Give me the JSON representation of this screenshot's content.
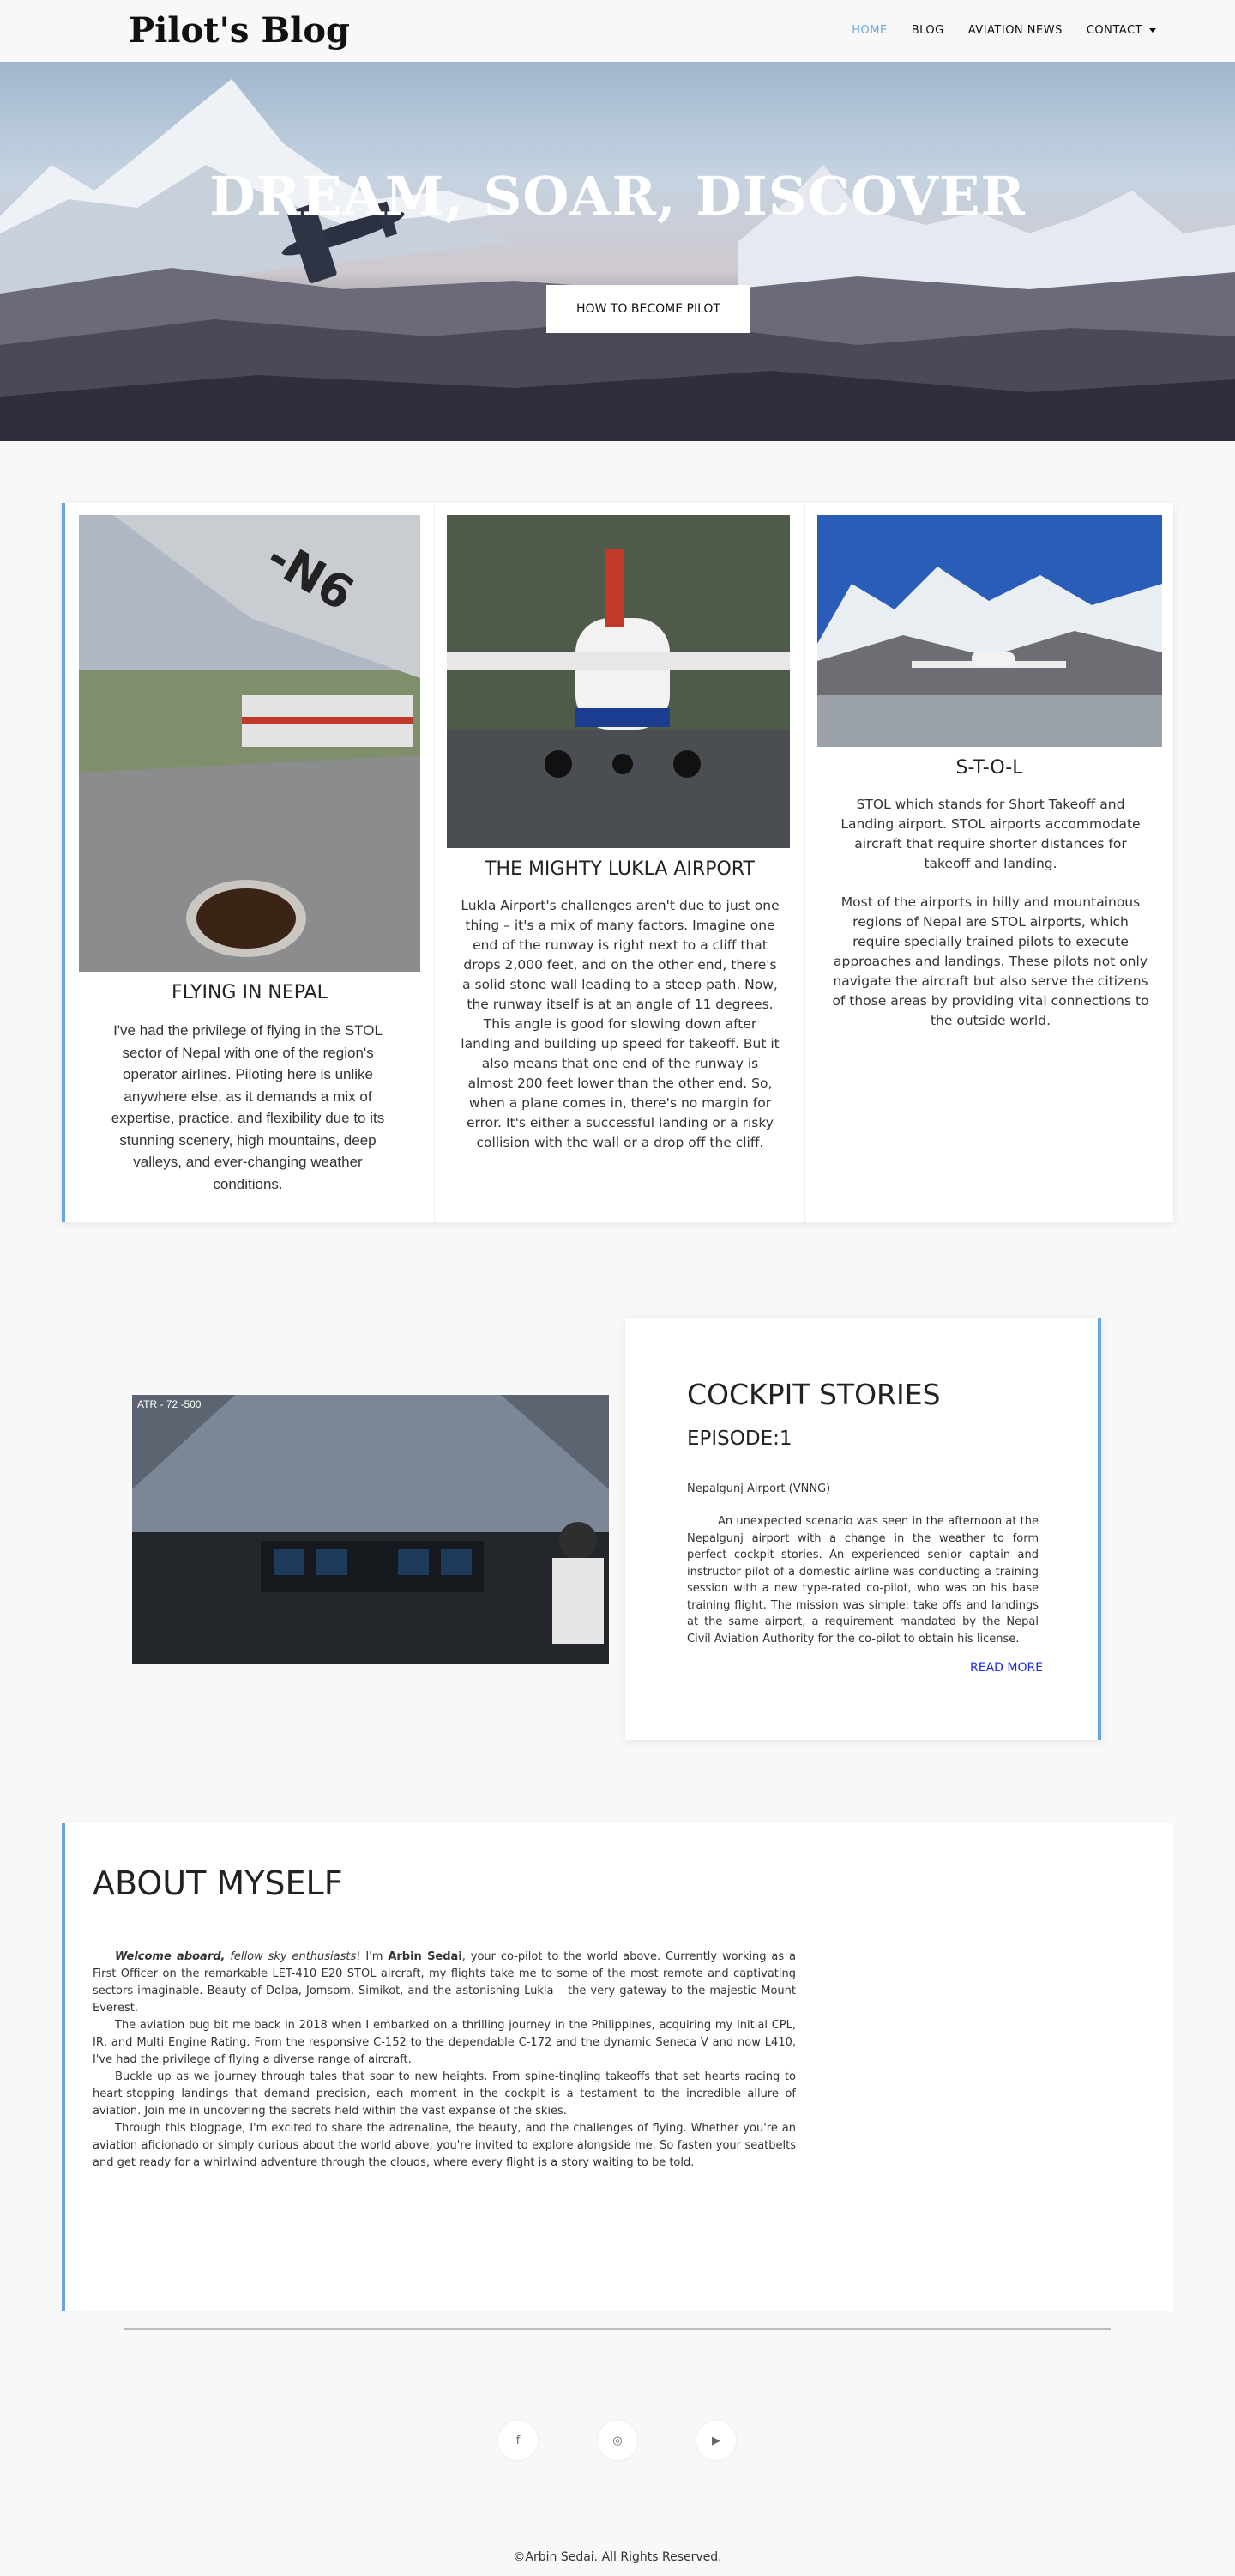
{
  "navbar": {
    "brand": "Pilot's Blog",
    "items": [
      {
        "label": "HOME"
      },
      {
        "label": "BLOG"
      },
      {
        "label": "AVIATION NEWS"
      },
      {
        "label": "CONTACT"
      }
    ]
  },
  "hero": {
    "title": "DREAM, SOAR, DISCOVER",
    "button": "HOW TO BECOME PILOT"
  },
  "cards": [
    {
      "title": "FLYING IN NEPAL",
      "text": "I've had the privilege of flying in the STOL sector of Nepal with one of the region's operator airlines. Piloting here is unlike anywhere else, as it demands a mix of expertise, practice, and flexibility due to its stunning scenery, high mountains, deep valleys, and ever-changing weather conditions."
    },
    {
      "title": "THE MIGHTY LUKLA AIRPORT",
      "text": "Lukla Airport's challenges aren't due to just one thing – it's a mix of many factors. Imagine one end of the runway is right next to a cliff that drops 2,000 feet, and on the other end, there's a solid stone wall leading to a steep path. Now, the runway itself is at an angle of 11 degrees. This angle is good for slowing down after landing and building up speed for takeoff. But it also means that one end of the runway is almost 200 feet lower than the other end. So, when a plane comes in, there's no margin for error. It's either a successful landing or a risky collision with the wall or a drop off the cliff."
    },
    {
      "title": "S-T-O-L",
      "text": "STOL which stands for Short Takeoff and Landing airport. STOL airports accommodate aircraft that require shorter distances for takeoff and landing.",
      "text2": "Most of the airports in  hilly and mountainous regions of Nepal are STOL airports, which require specially trained pilots to execute approaches and landings. These pilots not only navigate the aircraft but also serve the citizens of those areas by providing vital connections to the outside world."
    }
  ],
  "cockpit": {
    "image_caption": "ATR - 72 -500",
    "title": "COCKPIT STORIES",
    "episode": "EPISODE:1",
    "airport": "Nepalgunj Airport (VNNG)",
    "body": "An unexpected scenario was seen in the afternoon at the Nepalgunj airport with a change in the weather to form perfect cockpit stories. An experienced senior captain and instructor pilot of a domestic airline was conducting a training session with a new type-rated co-pilot, who was on his base training flight. The mission was simple: take offs and landings at the same airport, a requirement mandated by the Nepal Civil Aviation Authority for the co-pilot to obtain his license.",
    "read_more": "READ MORE"
  },
  "about": {
    "title": "ABOUT MYSELF",
    "p1_welcome": "Welcome aboard,",
    "p1_fellow": " fellow sky enthusiasts",
    "p1_a": "! I'm ",
    "p1_name": "Arbin Sedai",
    "p1_b": ", your co-pilot to the world above. Currently working as a First Officer on the remarkable LET-410 E20 STOL aircraft, my flights take me to some of the most remote and captivating sectors imaginable. Beauty of Dolpa, Jomsom, Simikot, and the astonishing Lukla – the very gateway to the majestic Mount Everest.",
    "p2": "The aviation bug bit me back in 2018 when I embarked on a thrilling journey in the Philippines, acquiring my Initial CPL, IR, and Multi Engine Rating. From the responsive C-152 to the dependable C-172 and the dynamic Seneca V and now L410, I've had the privilege of flying a diverse range of aircraft.",
    "p3": "Buckle up as we journey through tales that soar to new heights. From spine-tingling takeoffs that set hearts racing to heart-stopping landings that demand precision, each moment in the cockpit is a testament to the incredible allure of aviation. Join me in uncovering the secrets held within the vast expanse of the skies.",
    "p4": "Through this blogpage, I'm excited to share the adrenaline, the beauty, and the challenges of flying. Whether you're an aviation aficionado or simply curious about the world above, you're invited to explore alongside me. So fasten your seatbelts and get ready for a whirlwind adventure through the clouds, where every flight is a story waiting to be told."
  },
  "social": {
    "facebook": "f",
    "instagram": "◎",
    "youtube": "▶"
  },
  "footer": {
    "copyright": "©Arbin Sedai. All Rights Reserved."
  },
  "colors": {
    "accent": "#6aa6e6",
    "link": "#1b2fd8",
    "background": "#f8f8f8"
  }
}
